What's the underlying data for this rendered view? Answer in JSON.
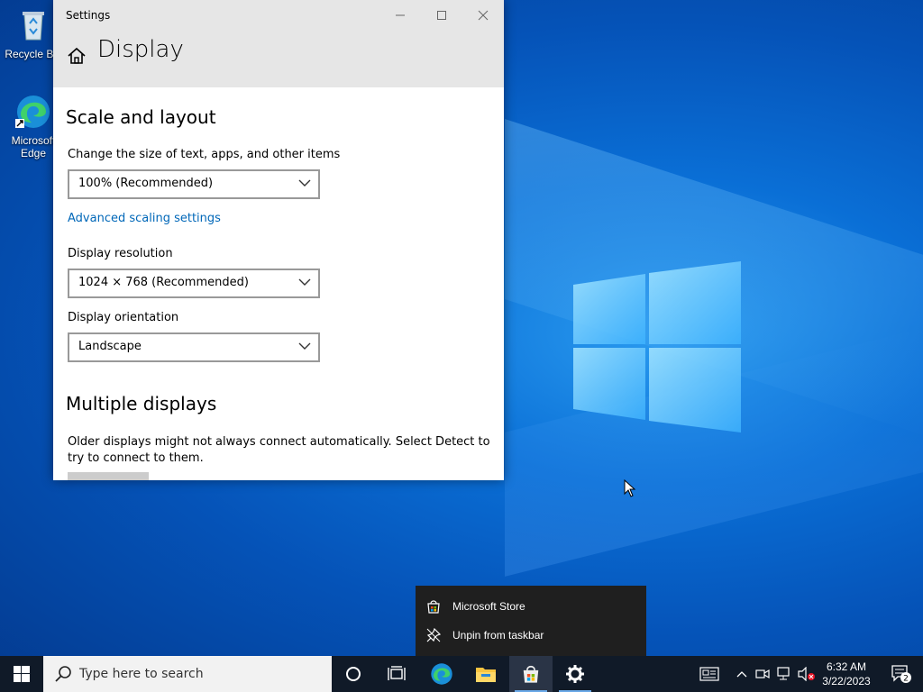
{
  "desktop": {
    "icons": [
      {
        "label": "Recycle Bin"
      },
      {
        "label": "Microsoft Edge"
      }
    ]
  },
  "settings": {
    "window_title": "Settings",
    "page_title": "Display",
    "section_scale": "Scale and layout",
    "scale_label": "Change the size of text, apps, and other items",
    "scale_value": "100% (Recommended)",
    "advanced_link": "Advanced scaling settings",
    "resolution_label": "Display resolution",
    "resolution_value": "1024 × 768 (Recommended)",
    "orientation_label": "Display orientation",
    "orientation_value": "Landscape",
    "section_multiple": "Multiple displays",
    "multiple_text_1": "Older displays might not always connect automatically. Select Detect to",
    "multiple_text_2": "try to connect to them."
  },
  "context_menu": {
    "items": [
      {
        "label": "Microsoft Store",
        "icon": "store-icon"
      },
      {
        "label": "Unpin from taskbar",
        "icon": "unpin-icon"
      }
    ]
  },
  "taskbar": {
    "search_placeholder": "Type here to search",
    "time": "6:32 AM",
    "date": "3/22/2023",
    "notification_count": "2"
  },
  "colors": {
    "accent": "#0067b8",
    "taskbar": "#101a28",
    "desktop": "#0a6fd6"
  }
}
